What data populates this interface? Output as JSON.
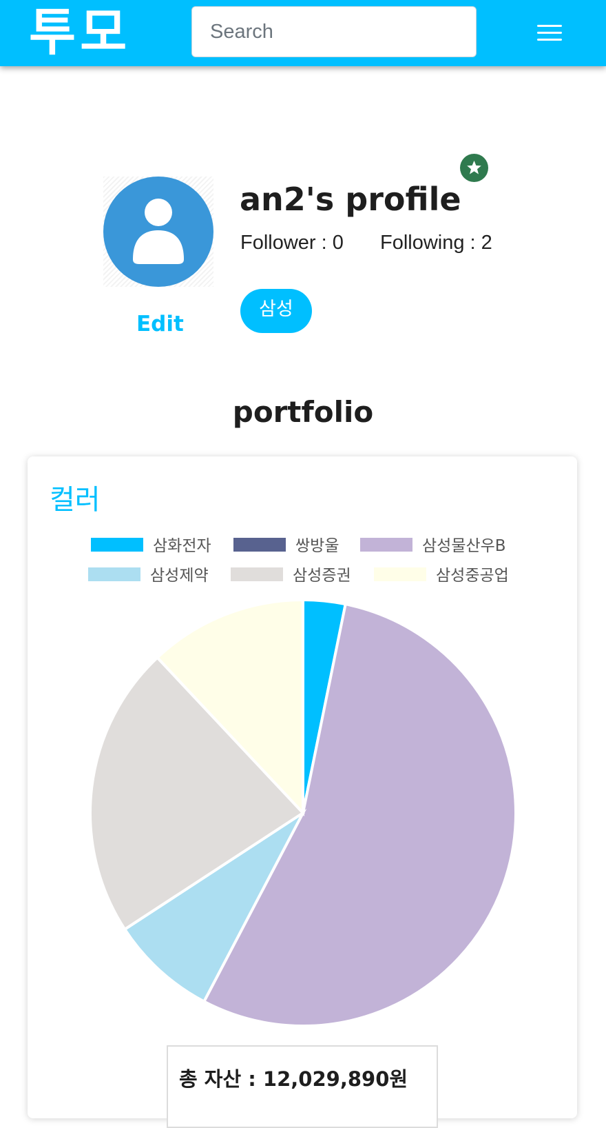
{
  "navbar": {
    "logo_text": "투모",
    "search_placeholder": "Search",
    "menu_icon": "hamburger-menu-icon",
    "background_color": "#00bfff"
  },
  "profile": {
    "title": "an2's profile",
    "follower_text": "Follower : 0",
    "following_text": "Following : 2",
    "edit_label": "Edit",
    "tag_label": "삼성",
    "avatar_icon": "user-avatar-icon",
    "badge_icon": "star-icon"
  },
  "portfolio": {
    "section_title": "portfolio",
    "card_title": "컬러",
    "total_assets": "총 자산 : 12,029,890원"
  },
  "chart_data": {
    "type": "pie",
    "categories": [
      "삼화전자",
      "쌍방울",
      "삼성물산우B",
      "삼성제약",
      "삼성증권",
      "삼성중공업"
    ],
    "values": [
      3.2,
      0,
      54.5,
      8.1,
      22.2,
      12.0
    ],
    "colors": [
      "#00bfff",
      "#58628f",
      "#c2b3d7",
      "#acdef1",
      "#e0dddb",
      "#fffee8"
    ],
    "legend_position": "top"
  }
}
